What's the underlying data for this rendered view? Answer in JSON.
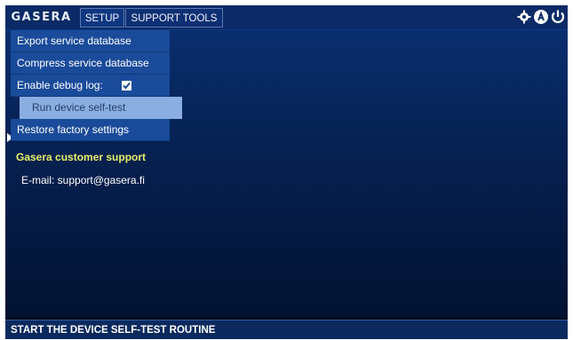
{
  "app": {
    "brand": "GASERA"
  },
  "tabs": [
    {
      "label": "SETUP",
      "active": true
    },
    {
      "label": "SUPPORT TOOLS",
      "active": false
    }
  ],
  "system_icons": [
    "gear-icon",
    "user-a-icon",
    "power-icon"
  ],
  "menu": {
    "items": [
      {
        "label": "Export service database"
      },
      {
        "label": "Compress service database"
      },
      {
        "label": "Enable debug log:",
        "checked": true
      },
      {
        "label": "Run device self-test",
        "selected": true
      },
      {
        "label": "Restore factory settings"
      }
    ]
  },
  "support": {
    "heading": "Gasera customer support",
    "email": "E-mail: support@gasera.fi"
  },
  "status": {
    "text": "START THE DEVICE SELF-TEST ROUTINE"
  },
  "colors": {
    "topbar": "#0b2a66",
    "menu_item": "#1a4b9a",
    "menu_selected": "#8aaee0",
    "heading_yellow": "#e8f06a"
  }
}
